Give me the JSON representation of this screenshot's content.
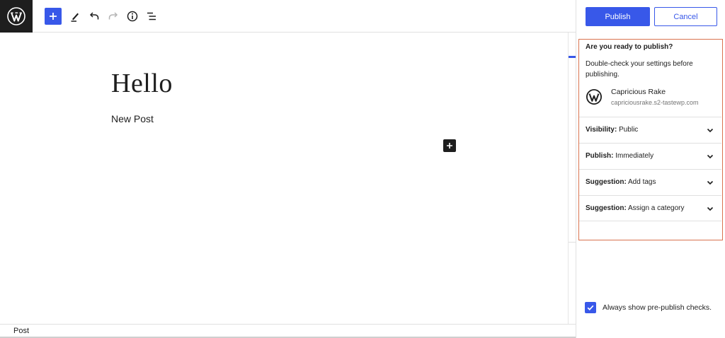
{
  "toolbar": {
    "logo_icon": "wordpress-logo",
    "add_block_icon": "plus-icon",
    "tools_icon": "pencil-icon",
    "undo_icon": "undo-icon",
    "redo_icon": "redo-icon",
    "details_icon": "info-icon",
    "list_view_icon": "list-view-icon"
  },
  "editor": {
    "title": "Hello",
    "paragraph": "New Post",
    "inserter_icon": "plus-icon"
  },
  "footer": {
    "breadcrumb": "Post"
  },
  "sidebar": {
    "publish_label": "Publish",
    "cancel_label": "Cancel",
    "prepublish": {
      "heading": "Are you ready to publish?",
      "description": "Double-check your settings before publishing.",
      "site_name": "Capricious Rake",
      "site_url": "capriciousrake.s2-tastewp.com",
      "rows": [
        {
          "key": "Visibility:",
          "value": "Public"
        },
        {
          "key": "Publish:",
          "value": "Immediately"
        },
        {
          "key": "Suggestion:",
          "value": "Add tags"
        },
        {
          "key": "Suggestion:",
          "value": "Assign a category"
        }
      ]
    },
    "always_show_label": "Always show pre-publish checks.",
    "always_show_checked": true
  },
  "colors": {
    "accent": "#3858e9",
    "highlight_border": "#d9734f",
    "dark": "#1e1e1e"
  }
}
